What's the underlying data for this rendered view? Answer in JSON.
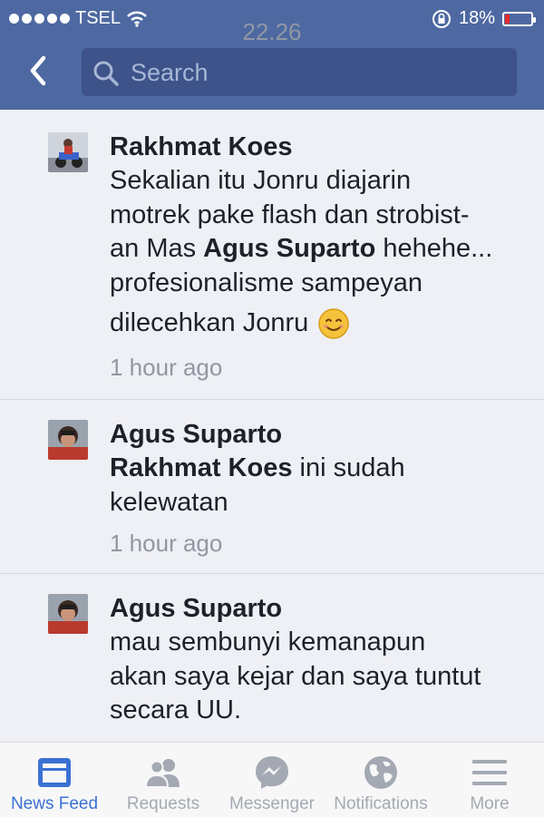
{
  "status_bar": {
    "carrier": "TSEL",
    "time": "22.26",
    "battery_percent": "18%",
    "battery_level": 0.18,
    "battery_color": "#e62a2a"
  },
  "nav": {
    "back_icon": "chevron-left-icon",
    "search_placeholder": "Search"
  },
  "comments": [
    {
      "author": "Rakhmat Koes",
      "text_lines": [
        "Sekalian itu Jonru diajarin",
        "motrek pake flash dan strobist-",
        "an Mas ",
        "Agus Suparto",
        " hehehe...",
        "profesionalisme sampeyan",
        "dilecehkan Jonru"
      ],
      "emoji": "smiling-face-icon",
      "time": "1 hour ago"
    },
    {
      "author": "Agus Suparto",
      "mention": "Rakhmat Koes",
      "text_after_mention": " ini sudah",
      "text_line2": "kelewatan",
      "time": "1 hour ago"
    },
    {
      "author": "Agus Suparto",
      "text_lines": [
        "mau sembunyi kemanapun",
        "akan saya kejar dan saya tuntut",
        "secara UU."
      ]
    }
  ],
  "tabs": [
    {
      "label": "News Feed",
      "icon": "news-feed-icon",
      "active": true
    },
    {
      "label": "Requests",
      "icon": "friend-requests-icon",
      "active": false
    },
    {
      "label": "Messenger",
      "icon": "messenger-icon",
      "active": false
    },
    {
      "label": "Notifications",
      "icon": "globe-icon",
      "active": false
    },
    {
      "label": "More",
      "icon": "hamburger-menu-icon",
      "active": false
    }
  ],
  "colors": {
    "header": "#4e69a2",
    "search_field": "#3d538a",
    "active_tab": "#3b71d3",
    "inactive_tab": "#a4a9b3"
  }
}
